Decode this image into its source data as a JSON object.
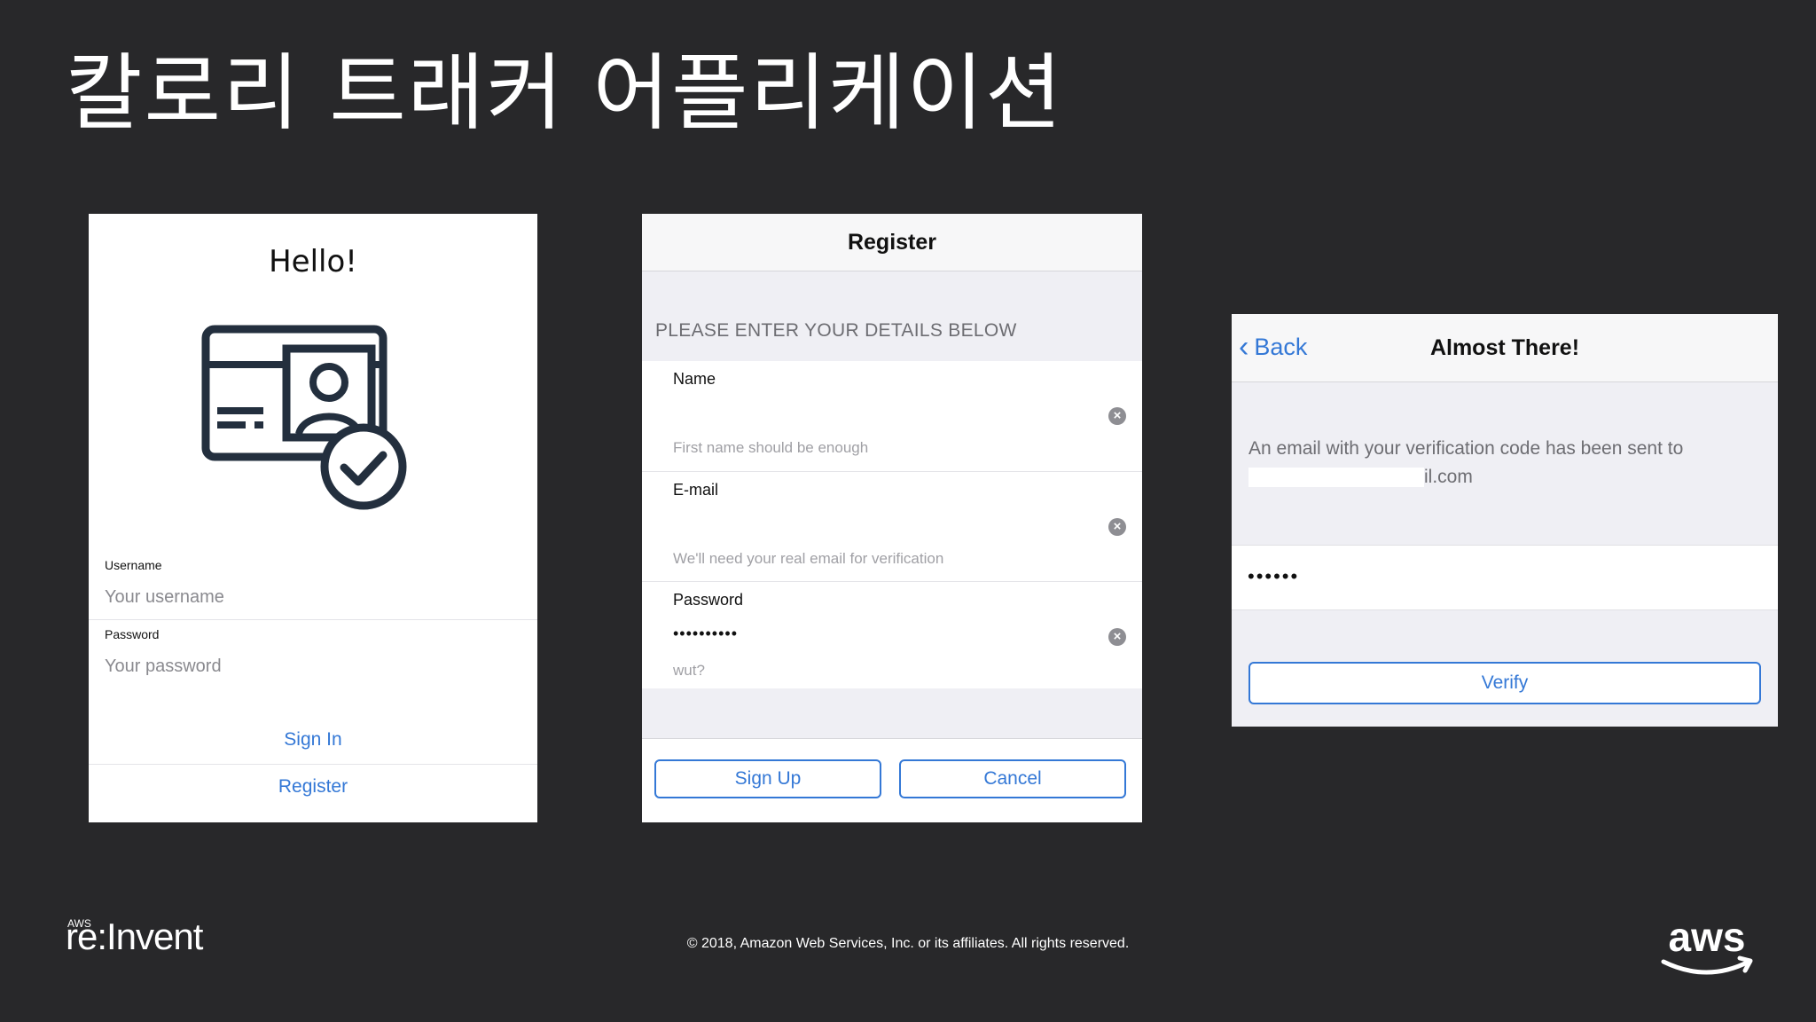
{
  "slide": {
    "title": "칼로리 트래커 어플리케이션",
    "copyright": "© 2018, Amazon Web Services, Inc. or its affiliates. All rights reserved.",
    "event_brand_small": "AWS",
    "event_brand": "re:Invent",
    "company_logo": "aws"
  },
  "signin": {
    "greeting": "Hello!",
    "illustration": "id-card-check-icon",
    "username_label": "Username",
    "username_placeholder": "Your username",
    "password_label": "Password",
    "password_placeholder": "Your password",
    "sign_in_label": "Sign In",
    "register_label": "Register"
  },
  "register": {
    "title": "Register",
    "section_header": "PLEASE ENTER YOUR DETAILS BELOW",
    "fields": [
      {
        "label": "Name",
        "value": "",
        "hint": "First name should be enough"
      },
      {
        "label": "E-mail",
        "value": "",
        "hint": "We'll need your real email for verification"
      },
      {
        "label": "Password",
        "value": "••••••••••",
        "hint": "wut?"
      }
    ],
    "sign_up_label": "Sign Up",
    "cancel_label": "Cancel"
  },
  "verify": {
    "back_label": "Back",
    "title": "Almost There!",
    "message": "An email with your verification code has been sent to",
    "email_suffix": "il.com",
    "code_value": "••••••",
    "verify_label": "Verify"
  },
  "colors": {
    "background": "#28282a",
    "accent": "#3478d6"
  }
}
